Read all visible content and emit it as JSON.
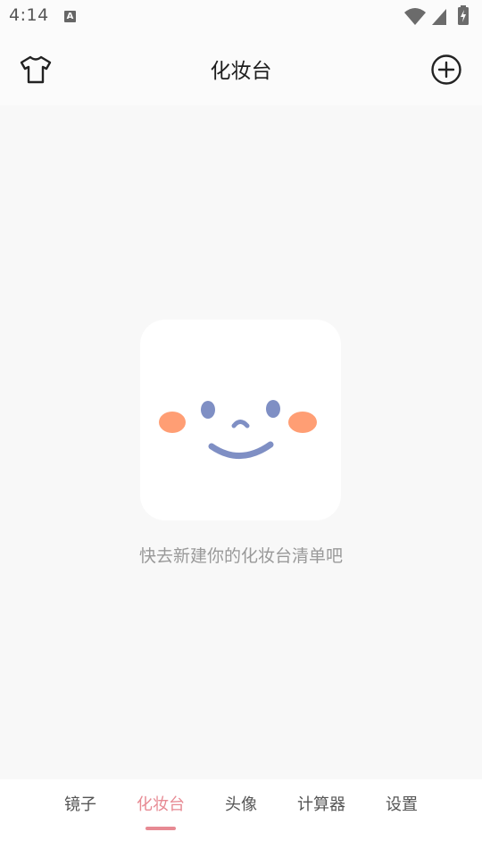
{
  "status_bar": {
    "time": "4:14",
    "notification_icon": "A",
    "icons": [
      "wifi-icon",
      "cellular-signal-icon",
      "battery-charging-icon"
    ]
  },
  "toolbar": {
    "title": "化妆台",
    "left_icon": "tshirt-icon",
    "right_icon": "add-circle-icon"
  },
  "empty_state": {
    "illustration": "smiling-face-icon",
    "message": "快去新建你的化妆台清单吧"
  },
  "bottom_nav": {
    "items": [
      {
        "label": "镜子"
      },
      {
        "label": "化妆台"
      },
      {
        "label": "头像"
      },
      {
        "label": "计算器"
      },
      {
        "label": "设置"
      }
    ],
    "active_index": 1
  },
  "colors": {
    "accent": "#e78a93",
    "face_blush": "#ff9e74",
    "face_features": "#7f8fc4"
  }
}
